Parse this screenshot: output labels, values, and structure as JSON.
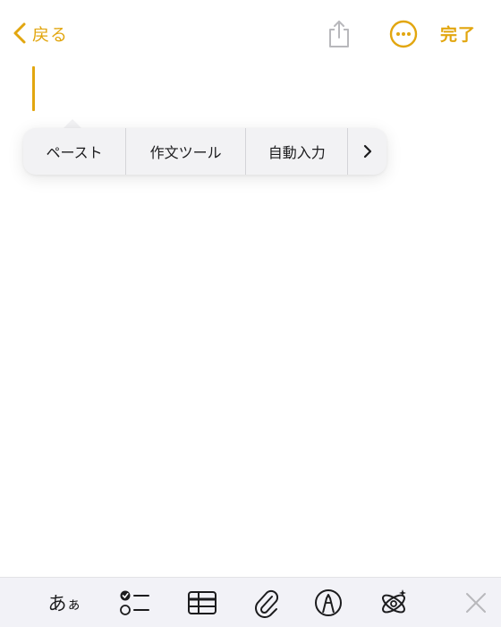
{
  "colors": {
    "accent": "#e2a60f",
    "text": "#1c1c1e",
    "disabled": "#b8b8bc"
  },
  "header": {
    "back_label": "戻る",
    "done_label": "完了",
    "back_icon": "chevron-left-icon",
    "share_icon": "share-icon",
    "more_icon": "ellipsis-circle-icon"
  },
  "context_menu": {
    "items": [
      {
        "label": "ペースト"
      },
      {
        "label": "作文ツール"
      },
      {
        "label": "自動入力"
      },
      {
        "label": ">"
      }
    ]
  },
  "toolbar": {
    "text_format_label_large": "あ",
    "text_format_label_small": "ぁ",
    "icons": [
      "text-format-icon",
      "checklist-icon",
      "table-icon",
      "paperclip-icon",
      "markup-pen-icon",
      "apple-intelligence-icon",
      "close-icon"
    ]
  }
}
